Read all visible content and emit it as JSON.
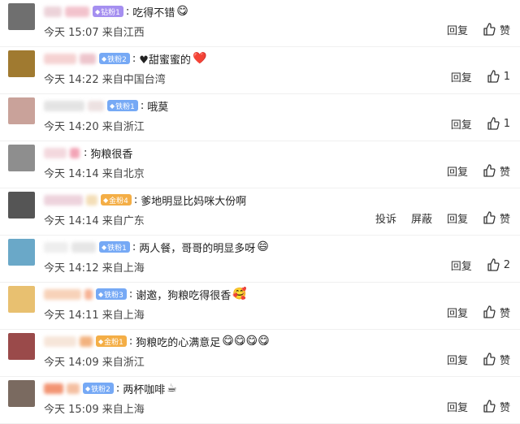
{
  "actions": {
    "reply": "回复",
    "report": "投诉",
    "block": "屏蔽",
    "like_default": "赞"
  },
  "comments": [
    {
      "badge": "钻粉1",
      "badge_color": "purple",
      "text": "吃得不错",
      "emoji": "😋",
      "time": "今天 15:07",
      "location": "来自江西",
      "likes": "赞",
      "avatar_color": "#6f6f6f",
      "name_colors": [
        "#e8c8d0",
        "#f0b4c0"
      ]
    },
    {
      "badge": "铁粉2",
      "badge_color": "blue",
      "text": "♥甜蜜蜜的",
      "emoji": "❤️",
      "time": "今天 14:22",
      "location": "来自中国台湾",
      "likes": "1",
      "avatar_color": "#a07a30",
      "name_colors": [
        "#f3c7c7",
        "#e9b7c0"
      ]
    },
    {
      "badge": "铁粉1",
      "badge_color": "blue",
      "text": "哦莫",
      "emoji": "",
      "time": "今天 14:20",
      "location": "来自浙江",
      "likes": "1",
      "avatar_color": "#c9a29a",
      "name_colors": [
        "#ddd",
        "#e8dada"
      ]
    },
    {
      "badge": "",
      "badge_color": "blue",
      "text": "狗粮很香",
      "emoji": "",
      "time": "今天 14:14",
      "location": "来自北京",
      "likes": "赞",
      "avatar_color": "#8e8e8e",
      "name_colors": [
        "#f1cfd6",
        "#f08ea4"
      ]
    },
    {
      "badge": "金粉4",
      "badge_color": "orange",
      "text": "爹地明显比妈咪大份啊",
      "emoji": "",
      "time": "今天 14:14",
      "location": "来自广东",
      "likes": "赞",
      "avatar_color": "#555",
      "name_colors": [
        "#e9c8d4",
        "#f1d6a6"
      ],
      "show_report": true
    },
    {
      "badge": "铁粉1",
      "badge_color": "blue",
      "text": "两人餐，哥哥的明显多呀",
      "emoji": "😄",
      "time": "今天 14:12",
      "location": "来自上海",
      "likes": "2",
      "avatar_color": "#6aa8c8",
      "name_colors": [
        "#eaeaea",
        "#e0e0e0"
      ]
    },
    {
      "badge": "铁粉3",
      "badge_color": "blue",
      "text": "谢邀，狗粮吃得很香",
      "emoji": "🥰",
      "time": "今天 14:11",
      "location": "来自上海",
      "likes": "赞",
      "avatar_color": "#e8c070",
      "name_colors": [
        "#f6c7a8",
        "#f5a07a"
      ]
    },
    {
      "badge": "金粉1",
      "badge_color": "orange",
      "text": "狗粮吃的心满意足",
      "emoji": "😋😋😋😋",
      "time": "今天 14:09",
      "location": "来自浙江",
      "likes": "赞",
      "avatar_color": "#9a4a4a",
      "name_colors": [
        "#f5e0d0",
        "#f0a060"
      ]
    },
    {
      "badge": "铁粉2",
      "badge_color": "blue",
      "text": "两杯咖啡",
      "emoji": "☕",
      "time": "今天 15:09",
      "location": "来自上海",
      "likes": "赞",
      "avatar_color": "#7a6a60",
      "name_colors": [
        "#f07a50",
        "#f2b08a"
      ]
    }
  ]
}
